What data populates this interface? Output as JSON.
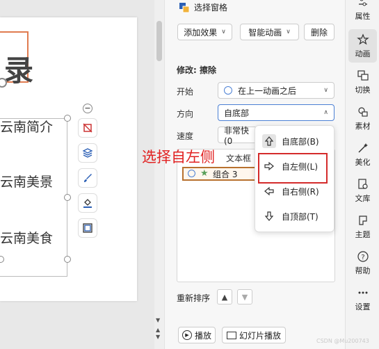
{
  "slide": {
    "title_char": "录",
    "lines": [
      "云南简介",
      "云南美景",
      "云南美食"
    ]
  },
  "pane": {
    "header": "选择窗格",
    "add_effect": "添加效果",
    "smart_anim": "智能动画",
    "delete": "删除",
    "modify_label": "修改: 擦除",
    "start_label": "开始",
    "start_value": "在上一动画之后",
    "direction_label": "方向",
    "direction_value": "自底部",
    "speed_label": "速度",
    "speed_value": "非常快(0",
    "text_obj": "文本框",
    "list_item": "组合 3",
    "reorder_label": "重新排序",
    "play": "播放",
    "slideshow": "幻灯片播放"
  },
  "dropdown": {
    "items": [
      {
        "label": "自底部(B)",
        "icon": "arrow-up-icon"
      },
      {
        "label": "自左侧(L)",
        "icon": "arrow-right-icon"
      },
      {
        "label": "自右侧(R)",
        "icon": "arrow-left-icon"
      },
      {
        "label": "自顶部(T)",
        "icon": "arrow-down-icon"
      }
    ]
  },
  "annotation": "选择自左侧",
  "sidebar": {
    "items": [
      {
        "label": "属性"
      },
      {
        "label": "动画"
      },
      {
        "label": "切换"
      },
      {
        "label": "素材"
      },
      {
        "label": "美化"
      },
      {
        "label": "文库"
      },
      {
        "label": "主题"
      },
      {
        "label": "帮助"
      },
      {
        "label": "设置"
      }
    ]
  },
  "watermark": "CSDN @Mu200743",
  "colors": {
    "annotation": "#e12020",
    "highlight": "#d42b2b",
    "selected_border": "#b8712f",
    "focus": "#4a7fd4"
  }
}
